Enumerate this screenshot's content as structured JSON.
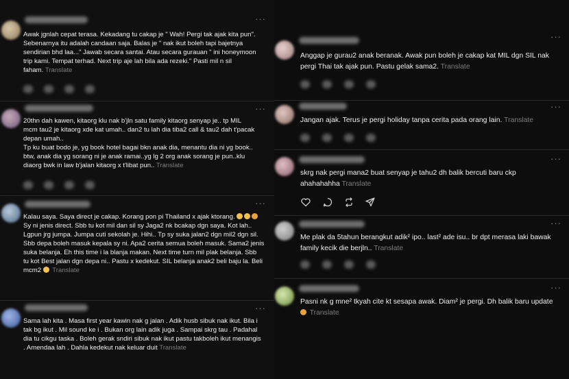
{
  "translate_label": "Translate",
  "more_label": "···",
  "left_column": {
    "posts": [
      {
        "text": "Awak jgnlah cepat terasa. Kekadang tu cakap je \" Wah! Pergi tak ajak kita pun\".\nSebenarnya itu adalah candaan saja. Balas je \" nak ikut boleh tapi bajetnya\nsendirian bhd laa...\" Jawab secara santai. Atau secara gurauan \" ini honeymoon\ntrip kami. Tempat terhad. Next trip aje lah bila ada rezeki.\" Pasti mil n sil\nfaham."
      },
      {
        "text": "20thn dah kawen, kitaorg klu nak b'jln satu family kitaorg senyap je.. tp MIL\nmcm tau2 je kitaorg xde kat umah.. dan2 tu lah dia tiba2 call & tau2 dah t'pacak\ndepan umah..\nTp ku buat bodo je, yg book hotel bagai bkn anak dia, menantu dia ni yg book..\nbtw, anak dia yg sorang ni je anak ramai..yg lg 2 org anak sorang je pun..klu\ndiaorg bwk in law b'jalan kitaorg x t'libat pun.."
      },
      {
        "text_before_emoji": "Kalau saya. Saya direct je cakap. Korang pon pi Thailand x ajak ktorang.",
        "text": "Sy ni jenis direct. Sbb tu kot mil dan sil sy Jaga2 nk bcakap dgn saya. Kot lah..\nLgpun jrg jumpa. Jumpa cuti sekolah je. Hihi.. Tp sy suka jalan2 dgn mil2 dgn sil.\nSbb depa boleh masuk kepala sy ni. Apa2 cerita semua boleh masuk. Sama2 jenis\nsuka belanja. Eh this time i la blanja makan. Next time turn mil plak belanja. Sbb\ntu kot Best jalan dgn depa ni.. Pastu x kedekut. SIL belanja anak2 beli baju la. Beli\nmcm2"
      },
      {
        "text": "Sama lah kita . Masa first year kawin nak g jalan . Adik husb sibuk nak ikut. Bila i\ntak bg ikut . Mil sound ke i . Bukan org lain adik juga . Sampai skrg tau . Padahal\ndia tu cikgu taska . Boleh gerak sndiri sibuk nak ikut pastu takboleh ikut menangis\n. Amendaa lah . Dahla kedekut nak keluar duit"
      }
    ]
  },
  "right_column": {
    "posts": [
      {
        "text": "Anggap je gurau2 anak beranak. Awak pun boleh je cakap kat MIL dgn SIL nak\npergi Thai tak ajak pun. Pastu gelak sama2."
      },
      {
        "text": "Jangan ajak. Terus je pergi holiday tanpa cerita pada orang lain."
      },
      {
        "text": "skrg nak pergi mana2 buat senyap je tahu2 dh balik bercuti baru ckp\nahahahahha",
        "actions": [
          "like-icon",
          "comment-icon",
          "repost-icon",
          "share-icon"
        ]
      },
      {
        "text": "Me plak da 5tahun berangkut adik² ipo.. last² ade isu.. br dpt merasa laki bawak\nfamily kecik die berjln.."
      },
      {
        "text": "Pasni nk g mne² tkyah cite kt sesapa awak. Diam² je pergi. Dh balik baru update"
      }
    ]
  },
  "colors": {
    "background": "#101010",
    "text": "#f0f0f0",
    "muted": "#7d7d7d",
    "divider": "#2a2a2a"
  }
}
